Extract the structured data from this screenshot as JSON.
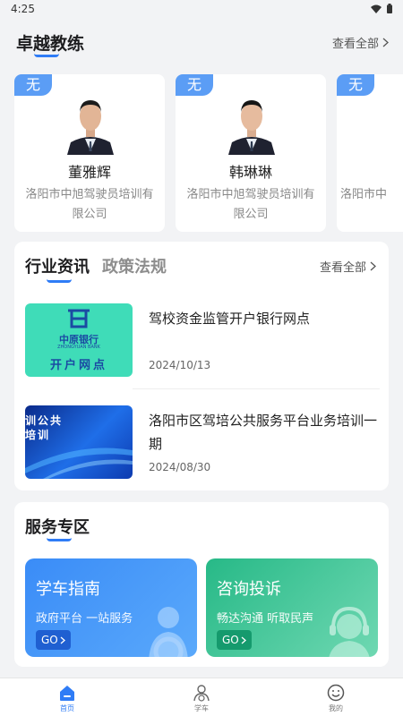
{
  "status_bar": {
    "time": "4:25"
  },
  "coaches": {
    "title": "卓越教练",
    "view_all": "查看全部",
    "items": [
      {
        "badge": "无",
        "name": "董雅辉",
        "school": "洛阳市中旭驾驶员培训有限公司"
      },
      {
        "badge": "无",
        "name": "韩琳琳",
        "school": "洛阳市中旭驾驶员培训有限公司"
      },
      {
        "badge": "无",
        "name": "",
        "school": "洛阳市中"
      }
    ]
  },
  "news": {
    "tabs": [
      "行业资讯",
      "政策法规"
    ],
    "view_all": "查看全部",
    "items": [
      {
        "title": "驾校资金监管开户银行网点",
        "date": "2024/10/13",
        "thumb_brand": "中原银行",
        "thumb_brand_en": "ZHONGYUAN BANK",
        "thumb_caption": "开户网点"
      },
      {
        "title": "洛阳市区驾培公共服务平台业务培训一期",
        "date": "2024/08/30",
        "thumb_line1": "训公共",
        "thumb_line2": "培训"
      }
    ]
  },
  "services": {
    "title": "服务专区",
    "items": [
      {
        "title": "学车指南",
        "subtitle": "政府平台 一站服务",
        "go": "GO",
        "color_from": "#3a8cf7",
        "color_to": "#5aa9fb"
      },
      {
        "title": "咨询投诉",
        "subtitle": "畅达沟通 听取民声",
        "go": "GO",
        "color_from": "#27b987",
        "color_to": "#6fd8b2"
      }
    ]
  },
  "tabbar": {
    "items": [
      {
        "label": "首页",
        "icon": "home-icon",
        "active": true
      },
      {
        "label": "学车",
        "icon": "learner-icon",
        "active": false
      },
      {
        "label": "我的",
        "icon": "smiley-icon",
        "active": false
      }
    ]
  },
  "colors": {
    "accent": "#2f7cf6",
    "badge": "#5b9df5"
  }
}
